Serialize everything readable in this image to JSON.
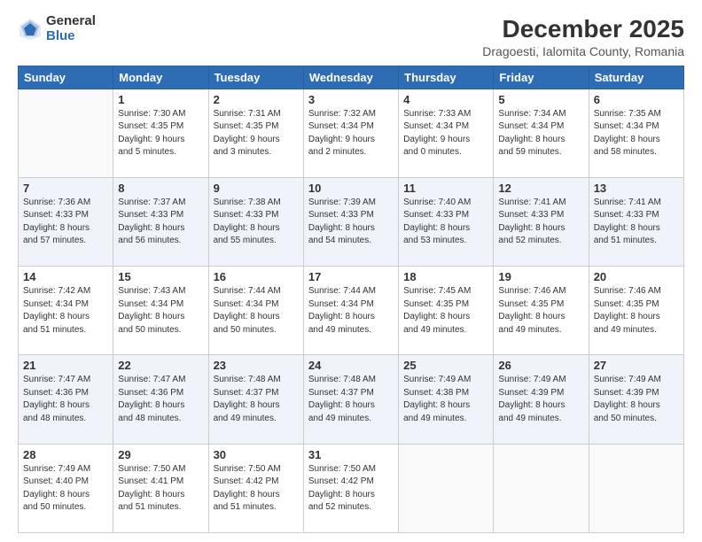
{
  "logo": {
    "general": "General",
    "blue": "Blue"
  },
  "title": "December 2025",
  "subtitle": "Dragoesti, Ialomita County, Romania",
  "weekdays": [
    "Sunday",
    "Monday",
    "Tuesday",
    "Wednesday",
    "Thursday",
    "Friday",
    "Saturday"
  ],
  "weeks": [
    [
      {
        "date": "",
        "info": ""
      },
      {
        "date": "1",
        "info": "Sunrise: 7:30 AM\nSunset: 4:35 PM\nDaylight: 9 hours\nand 5 minutes."
      },
      {
        "date": "2",
        "info": "Sunrise: 7:31 AM\nSunset: 4:35 PM\nDaylight: 9 hours\nand 3 minutes."
      },
      {
        "date": "3",
        "info": "Sunrise: 7:32 AM\nSunset: 4:34 PM\nDaylight: 9 hours\nand 2 minutes."
      },
      {
        "date": "4",
        "info": "Sunrise: 7:33 AM\nSunset: 4:34 PM\nDaylight: 9 hours\nand 0 minutes."
      },
      {
        "date": "5",
        "info": "Sunrise: 7:34 AM\nSunset: 4:34 PM\nDaylight: 8 hours\nand 59 minutes."
      },
      {
        "date": "6",
        "info": "Sunrise: 7:35 AM\nSunset: 4:34 PM\nDaylight: 8 hours\nand 58 minutes."
      }
    ],
    [
      {
        "date": "7",
        "info": "Sunrise: 7:36 AM\nSunset: 4:33 PM\nDaylight: 8 hours\nand 57 minutes."
      },
      {
        "date": "8",
        "info": "Sunrise: 7:37 AM\nSunset: 4:33 PM\nDaylight: 8 hours\nand 56 minutes."
      },
      {
        "date": "9",
        "info": "Sunrise: 7:38 AM\nSunset: 4:33 PM\nDaylight: 8 hours\nand 55 minutes."
      },
      {
        "date": "10",
        "info": "Sunrise: 7:39 AM\nSunset: 4:33 PM\nDaylight: 8 hours\nand 54 minutes."
      },
      {
        "date": "11",
        "info": "Sunrise: 7:40 AM\nSunset: 4:33 PM\nDaylight: 8 hours\nand 53 minutes."
      },
      {
        "date": "12",
        "info": "Sunrise: 7:41 AM\nSunset: 4:33 PM\nDaylight: 8 hours\nand 52 minutes."
      },
      {
        "date": "13",
        "info": "Sunrise: 7:41 AM\nSunset: 4:33 PM\nDaylight: 8 hours\nand 51 minutes."
      }
    ],
    [
      {
        "date": "14",
        "info": "Sunrise: 7:42 AM\nSunset: 4:34 PM\nDaylight: 8 hours\nand 51 minutes."
      },
      {
        "date": "15",
        "info": "Sunrise: 7:43 AM\nSunset: 4:34 PM\nDaylight: 8 hours\nand 50 minutes."
      },
      {
        "date": "16",
        "info": "Sunrise: 7:44 AM\nSunset: 4:34 PM\nDaylight: 8 hours\nand 50 minutes."
      },
      {
        "date": "17",
        "info": "Sunrise: 7:44 AM\nSunset: 4:34 PM\nDaylight: 8 hours\nand 49 minutes."
      },
      {
        "date": "18",
        "info": "Sunrise: 7:45 AM\nSunset: 4:35 PM\nDaylight: 8 hours\nand 49 minutes."
      },
      {
        "date": "19",
        "info": "Sunrise: 7:46 AM\nSunset: 4:35 PM\nDaylight: 8 hours\nand 49 minutes."
      },
      {
        "date": "20",
        "info": "Sunrise: 7:46 AM\nSunset: 4:35 PM\nDaylight: 8 hours\nand 49 minutes."
      }
    ],
    [
      {
        "date": "21",
        "info": "Sunrise: 7:47 AM\nSunset: 4:36 PM\nDaylight: 8 hours\nand 48 minutes."
      },
      {
        "date": "22",
        "info": "Sunrise: 7:47 AM\nSunset: 4:36 PM\nDaylight: 8 hours\nand 48 minutes."
      },
      {
        "date": "23",
        "info": "Sunrise: 7:48 AM\nSunset: 4:37 PM\nDaylight: 8 hours\nand 49 minutes."
      },
      {
        "date": "24",
        "info": "Sunrise: 7:48 AM\nSunset: 4:37 PM\nDaylight: 8 hours\nand 49 minutes."
      },
      {
        "date": "25",
        "info": "Sunrise: 7:49 AM\nSunset: 4:38 PM\nDaylight: 8 hours\nand 49 minutes."
      },
      {
        "date": "26",
        "info": "Sunrise: 7:49 AM\nSunset: 4:39 PM\nDaylight: 8 hours\nand 49 minutes."
      },
      {
        "date": "27",
        "info": "Sunrise: 7:49 AM\nSunset: 4:39 PM\nDaylight: 8 hours\nand 50 minutes."
      }
    ],
    [
      {
        "date": "28",
        "info": "Sunrise: 7:49 AM\nSunset: 4:40 PM\nDaylight: 8 hours\nand 50 minutes."
      },
      {
        "date": "29",
        "info": "Sunrise: 7:50 AM\nSunset: 4:41 PM\nDaylight: 8 hours\nand 51 minutes."
      },
      {
        "date": "30",
        "info": "Sunrise: 7:50 AM\nSunset: 4:42 PM\nDaylight: 8 hours\nand 51 minutes."
      },
      {
        "date": "31",
        "info": "Sunrise: 7:50 AM\nSunset: 4:42 PM\nDaylight: 8 hours\nand 52 minutes."
      },
      {
        "date": "",
        "info": ""
      },
      {
        "date": "",
        "info": ""
      },
      {
        "date": "",
        "info": ""
      }
    ]
  ]
}
